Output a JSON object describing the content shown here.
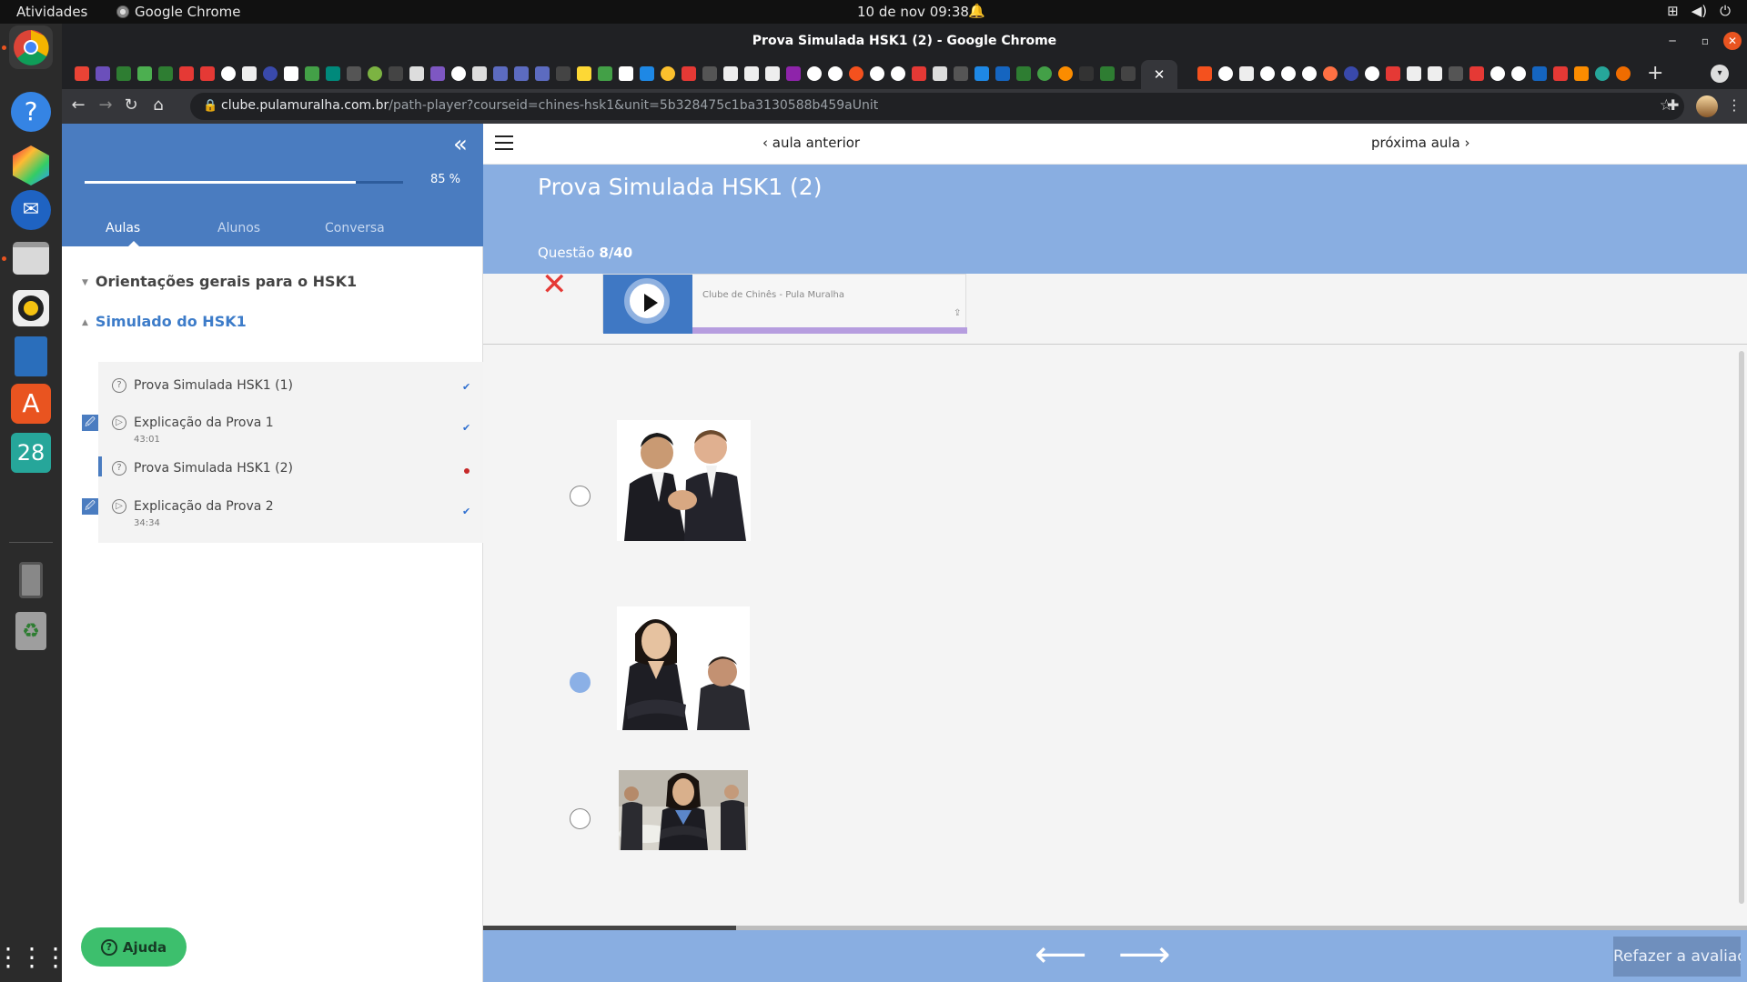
{
  "desktop": {
    "activities": "Atividades",
    "app_name": "Google Chrome",
    "clock": "10 de nov  09:38"
  },
  "window": {
    "title": "Prova Simulada HSK1 (2) - Google Chrome"
  },
  "browser": {
    "url_host": "clube.pulamuralha.com.br",
    "url_path": "/path-player?courseid=chines-hsk1&unit=5b328475c1ba3130588b459aUnit",
    "active_tab_close": "✕",
    "new_tab": "+"
  },
  "sidebar": {
    "progress_percent": 85,
    "progress_label": "85 %",
    "tabs": [
      {
        "label": "Aulas"
      },
      {
        "label": "Alunos"
      },
      {
        "label": "Conversa"
      }
    ],
    "sections": [
      {
        "title": "Orientações gerais para o HSK1"
      },
      {
        "title": "Simulado do HSK1"
      }
    ],
    "lessons": [
      {
        "title": "Prova Simulada HSK1 (1)",
        "duration": "",
        "status": "done"
      },
      {
        "title": "Explicação da Prova 1",
        "duration": "43:01",
        "status": "done"
      },
      {
        "title": "Prova Simulada HSK1 (2)",
        "duration": "",
        "status": "current"
      },
      {
        "title": "Explicação da Prova 2",
        "duration": "34:34",
        "status": "done"
      }
    ],
    "help_label": "Ajuda"
  },
  "main": {
    "prev_label": "aula anterior",
    "next_label": "próxima aula",
    "title": "Prova Simulada HSK1 (2)",
    "question_prefix": "Questão",
    "question_counter": "8/40",
    "question_progress": 0.2,
    "player": {
      "name": "Clube de Chinês - Pula Muralha"
    },
    "options": [
      {
        "image": "two-men-in-suits-shaking-hands",
        "selected": false
      },
      {
        "image": "businesswoman-arms-crossed-with-colleague",
        "selected": true
      },
      {
        "image": "businesswoman-in-front-of-meeting",
        "selected": false
      }
    ],
    "redo_label": "Refazer a avaliação?"
  },
  "colors": {
    "sidebar_header": "#4a7cc0",
    "banner": "#89aee1",
    "accent_green": "#3dbf6d",
    "wrong_mark": "#e53935"
  }
}
